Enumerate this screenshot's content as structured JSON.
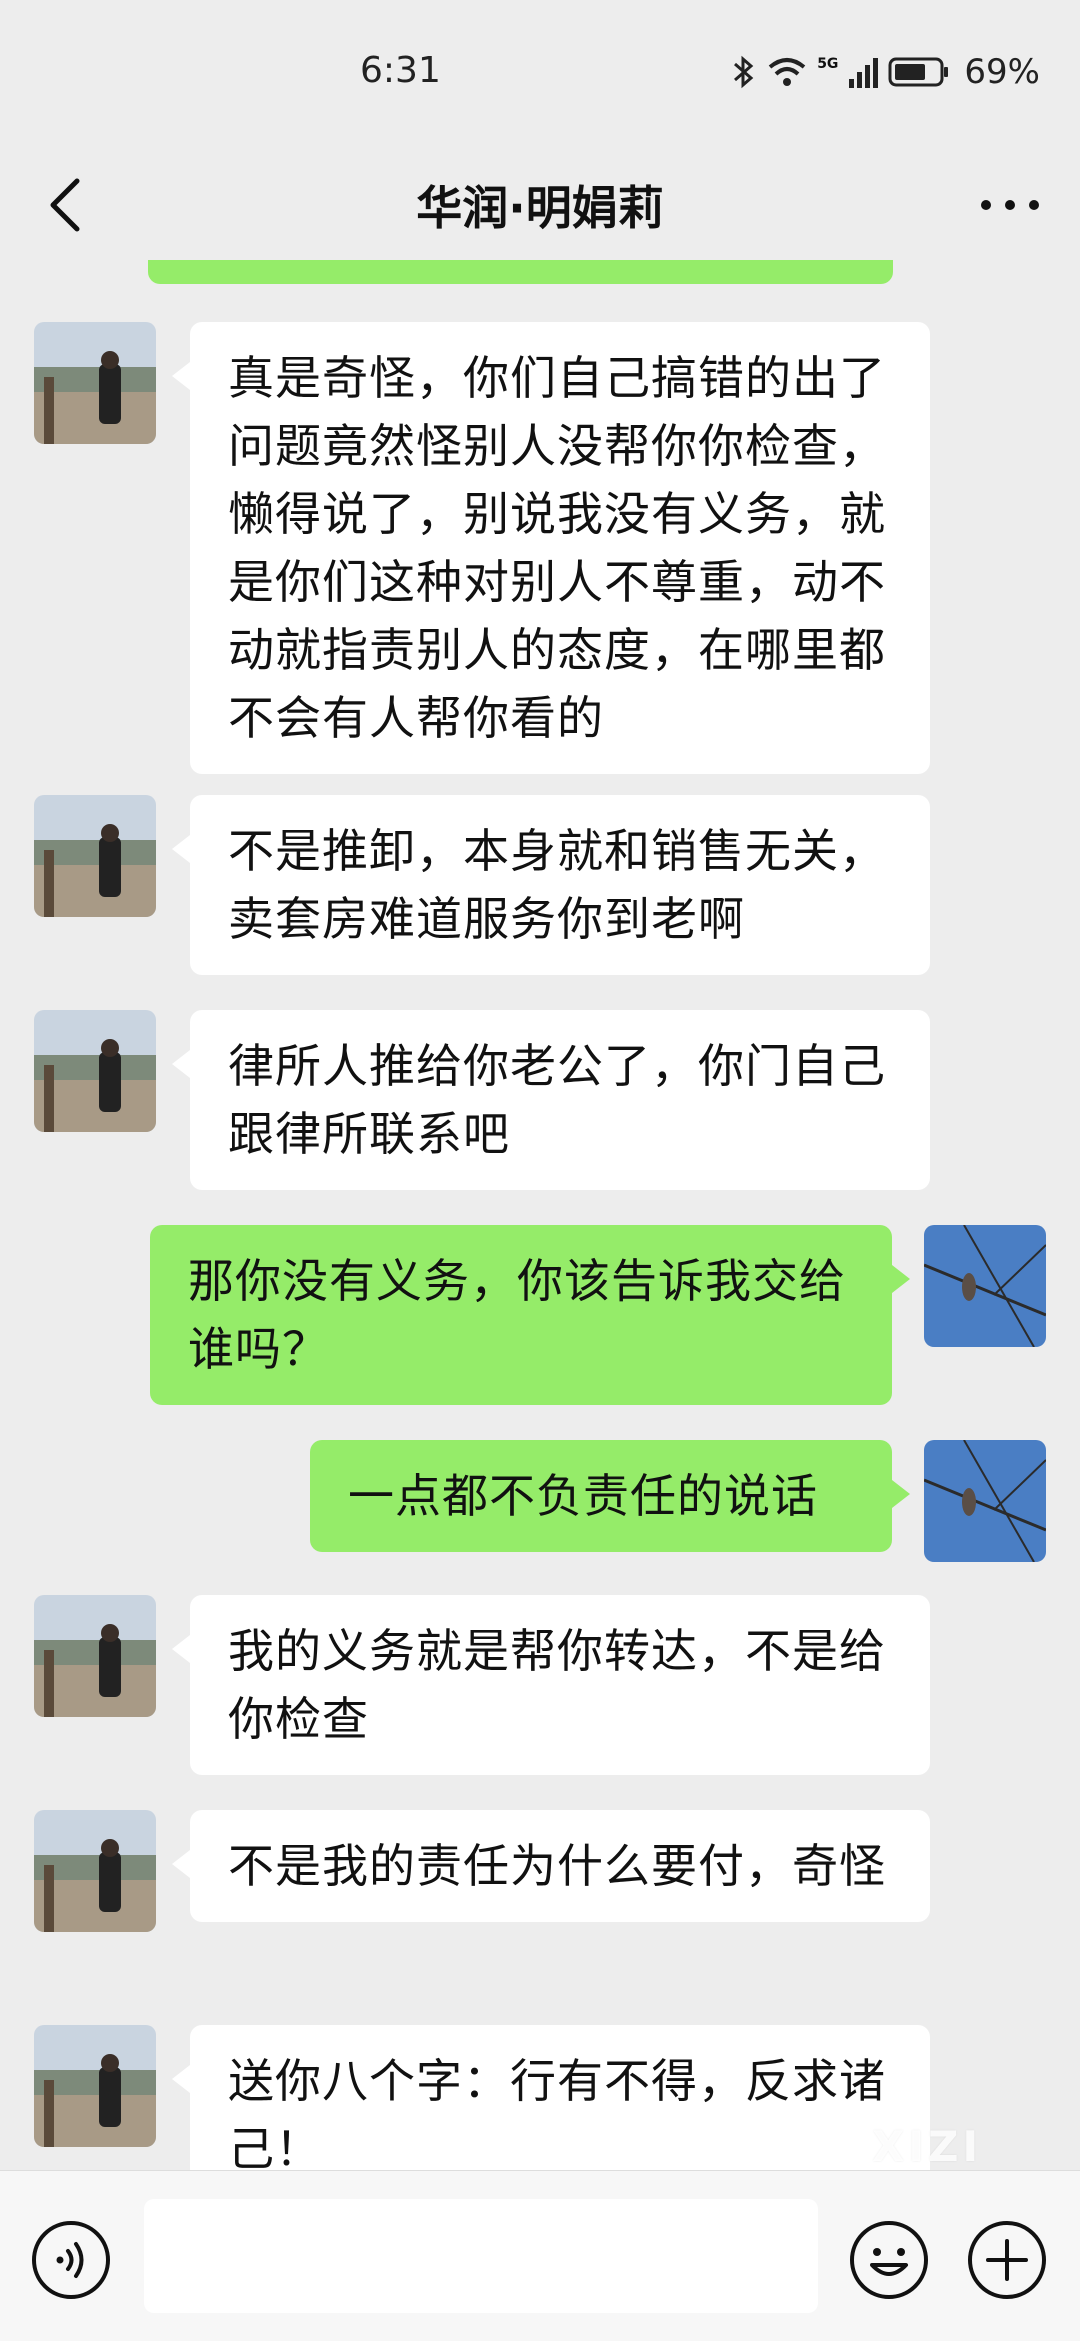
{
  "status_bar": {
    "time": "6:31",
    "network": "5G",
    "battery": "69%"
  },
  "header": {
    "title": "华润·明娟莉",
    "back_icon": "chevron-left-icon",
    "more_icon": "more-dots-icon"
  },
  "messages": [
    {
      "side": "left",
      "avatar": "contact-avatar",
      "text": "真是奇怪，你们自己搞错的出了问题竟然怪别人没帮你你检查，懒得说了，别说我没有义务，就是你们这种对别人不尊重，动不动就指责别人的态度，在哪里都不会有人帮你看的"
    },
    {
      "side": "left",
      "avatar": "contact-avatar",
      "text": "不是推卸，本身就和销售无关，卖套房难道服务你到老啊"
    },
    {
      "side": "left",
      "avatar": "contact-avatar",
      "text": "律所人推给你老公了，你门自己跟律所联系吧"
    },
    {
      "side": "right",
      "avatar": "my-avatar",
      "text": "那你没有义务，你该告诉我交给谁吗？"
    },
    {
      "side": "right",
      "avatar": "my-avatar",
      "text": "一点都不负责任的说话"
    },
    {
      "side": "left",
      "avatar": "contact-avatar",
      "text": "我的义务就是帮你转达，不是给你检查"
    },
    {
      "side": "left",
      "avatar": "contact-avatar",
      "text": "不是我的责任为什么要付，奇怪"
    },
    {
      "side": "left",
      "avatar": "contact-avatar",
      "text": "送你八个字：行有不得，反求诸己！"
    }
  ],
  "input_bar": {
    "placeholder": "",
    "voice_icon": "voice-icon",
    "emoji_icon": "emoji-icon",
    "plus_icon": "plus-icon"
  },
  "watermark": "XIZI",
  "colors": {
    "background": "#ededed",
    "sent_bubble": "#95ec69",
    "received_bubble": "#ffffff"
  }
}
